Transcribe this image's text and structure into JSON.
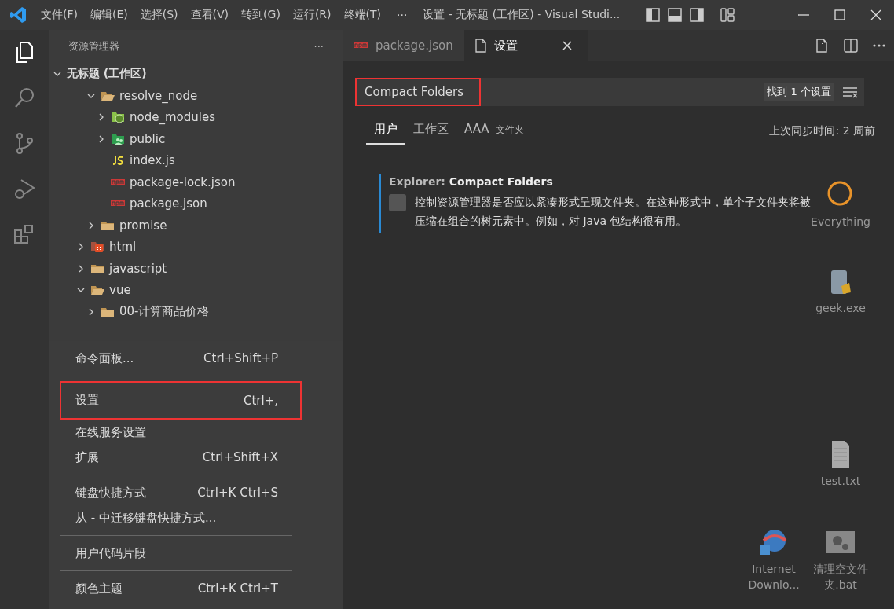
{
  "title_bar": {
    "menus": [
      "文件(F)",
      "编辑(E)",
      "选择(S)",
      "查看(V)",
      "转到(G)",
      "运行(R)",
      "终端(T)"
    ],
    "more": "···",
    "title": "设置 - 无标题 (工作区) - Visual Studi..."
  },
  "activity_bar": {
    "items": [
      {
        "kind": "files",
        "selected": true
      },
      {
        "kind": "search",
        "selected": false
      },
      {
        "kind": "source-control",
        "selected": false
      },
      {
        "kind": "run-debug",
        "selected": false
      },
      {
        "kind": "extensions",
        "selected": false
      }
    ]
  },
  "sidebar": {
    "title": "资源管理器",
    "more": "···",
    "workspace": {
      "label": "无标题 (工作区)",
      "expanded": true
    },
    "tree": [
      {
        "children": [
          {
            "label": "resolve_node",
            "kind": "folder",
            "expanded": true,
            "children": [
              {
                "label": "node_modules",
                "kind": "node",
                "expanded": false
              },
              {
                "label": "public",
                "kind": "public",
                "expanded": false
              },
              {
                "label": "index.js",
                "kind": "js"
              },
              {
                "label": "package-lock.json",
                "kind": "npm"
              },
              {
                "label": "package.json",
                "kind": "npm"
              }
            ]
          },
          {
            "label": "promise",
            "kind": "folder",
            "expanded": false
          }
        ]
      },
      {
        "label": "html",
        "kind": "html",
        "expanded": false
      },
      {
        "label": "javascript",
        "kind": "folder",
        "expanded": false
      },
      {
        "label": "vue",
        "kind": "folder",
        "expanded": true,
        "children": [
          {
            "label": "00-计算商品价格",
            "kind": "folder",
            "expanded": false
          }
        ]
      }
    ]
  },
  "editor": {
    "tabs": [
      {
        "label": "package.json",
        "kind": "npm",
        "selected": false
      },
      {
        "label": "设置",
        "kind": "file",
        "selected": true
      }
    ],
    "settings": {
      "search": {
        "value": "Compact Folders",
        "highlighted": true
      },
      "result_count": "找到 1 个设置",
      "scopes": [
        {
          "label": "用户",
          "selected": true
        },
        {
          "label": "工作区",
          "selected": false
        },
        {
          "label": "AAA",
          "hint": "文件夹",
          "selected": false
        }
      ],
      "sync": "上次同步时间: 2 周前",
      "setting": {
        "category": "Explorer: ",
        "name": "Compact Folders",
        "checked": false,
        "description": "控制资源管理器是否应以紧凑形式呈现文件夹。在这种形式中，单个子文件夹将被压缩在组合的树元素中。例如，对 Java 包结构很有用。"
      }
    }
  },
  "menu": {
    "groups": [
      [
        {
          "label": "命令面板...",
          "shortcut": "Ctrl+Shift+P",
          "highlighted": false
        }
      ],
      [
        {
          "label": "设置",
          "shortcut": "Ctrl+,",
          "highlighted": true
        },
        {
          "label": "在线服务设置",
          "highlighted": false
        },
        {
          "label": "扩展",
          "shortcut": "Ctrl+Shift+X",
          "highlighted": false
        }
      ],
      [
        {
          "label": "键盘快捷方式",
          "shortcut": "Ctrl+K Ctrl+S",
          "highlighted": false
        },
        {
          "label": "从 - 中迁移键盘快捷方式...",
          "highlighted": false
        }
      ],
      [
        {
          "label": "用户代码片段",
          "highlighted": false
        }
      ],
      [
        {
          "label": "颜色主题",
          "shortcut": "Ctrl+K Ctrl+T",
          "highlighted": false
        }
      ]
    ]
  },
  "desktop": {
    "icons": [
      {
        "label": "Everything",
        "kind": "app"
      },
      {
        "label": "geek.exe",
        "kind": "exe"
      },
      {
        "label": "test.txt",
        "kind": "text"
      },
      {
        "label": "Internet Downlo...",
        "kind": "shortcut"
      },
      {
        "label": "清理空文件夹.bat",
        "kind": "bat"
      }
    ]
  }
}
